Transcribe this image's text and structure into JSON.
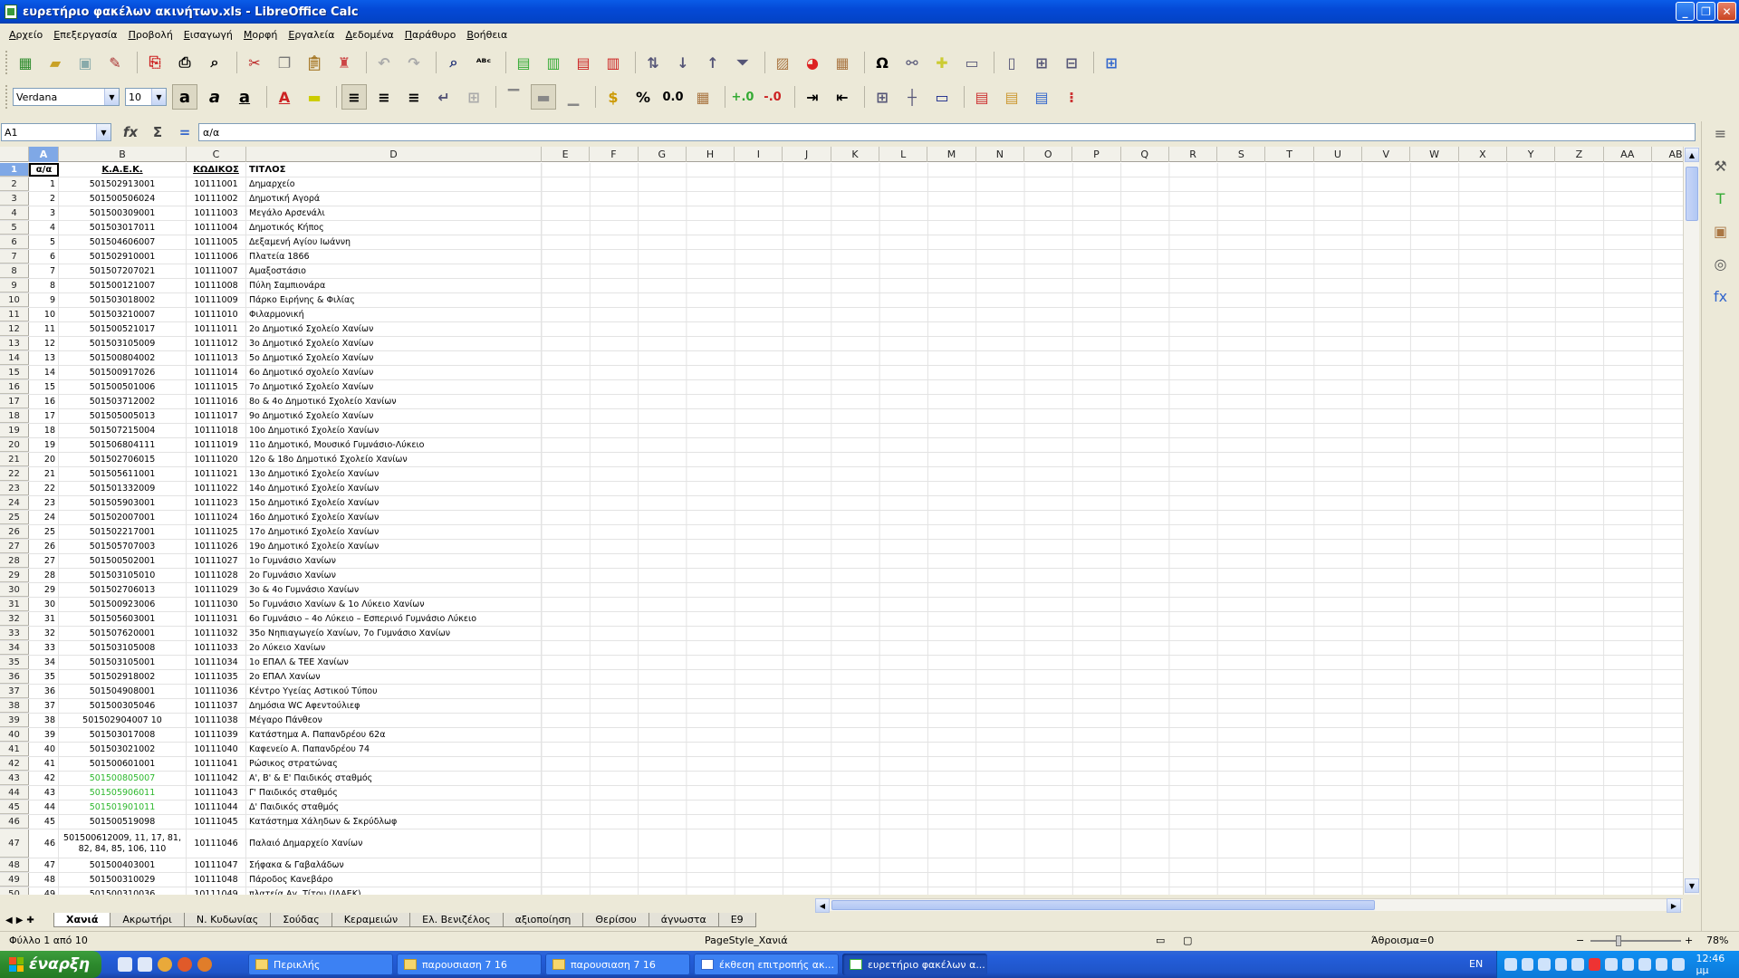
{
  "window": {
    "title": "ευρετήριο φακέλων ακινήτων.xls - LibreOffice Calc"
  },
  "menu": [
    "Αρχείο",
    "Επεξεργασία",
    "Προβολή",
    "Εισαγωγή",
    "Μορφή",
    "Εργαλεία",
    "Δεδομένα",
    "Παράθυρο",
    "Βοήθεια"
  ],
  "format": {
    "font_name": "Verdana",
    "font_size": "10"
  },
  "formula_bar": {
    "cell_ref": "A1",
    "content": "α/α"
  },
  "columns": [
    "A",
    "B",
    "C",
    "D",
    "E",
    "F",
    "G",
    "H",
    "I",
    "J",
    "K",
    "L",
    "M",
    "N",
    "O",
    "P",
    "Q",
    "R",
    "S",
    "T",
    "U",
    "V",
    "W",
    "X",
    "Y",
    "Z",
    "AA",
    "AB"
  ],
  "header_row": {
    "a": "α/α",
    "b": "Κ.Α.Ε.Κ.",
    "c": "ΚΩΔΙΚΟΣ",
    "d": "ΤΙΤΛΟΣ"
  },
  "rows": [
    {
      "n": "1",
      "b": "501502913001",
      "c": "10111001",
      "d": "Δημαρχείο"
    },
    {
      "n": "2",
      "b": "501500506024",
      "c": "10111002",
      "d": "Δημοτική Αγορά"
    },
    {
      "n": "3",
      "b": "501500309001",
      "c": "10111003",
      "d": "Μεγάλο Αρσενάλι"
    },
    {
      "n": "4",
      "b": "501503017011",
      "c": "10111004",
      "d": "Δημοτικός Κήπος"
    },
    {
      "n": "5",
      "b": "501504606007",
      "c": "10111005",
      "d": "Δεξαμενή Αγίου Ιωάννη"
    },
    {
      "n": "6",
      "b": "501502910001",
      "c": "10111006",
      "d": "Πλατεία 1866"
    },
    {
      "n": "7",
      "b": "501507207021",
      "c": "10111007",
      "d": "Αμαξοστάσιο"
    },
    {
      "n": "8",
      "b": "501500121007",
      "c": "10111008",
      "d": "Πύλη Σαμπιονάρα"
    },
    {
      "n": "9",
      "b": "501503018002",
      "c": "10111009",
      "d": "Πάρκο Ειρήνης & Φιλίας"
    },
    {
      "n": "10",
      "b": "501503210007",
      "c": "10111010",
      "d": "Φιλαρμονική"
    },
    {
      "n": "11",
      "b": "501500521017",
      "c": "10111011",
      "d": "2ο Δημοτικό Σχολείο Χανίων"
    },
    {
      "n": "12",
      "b": "501503105009",
      "c": "10111012",
      "d": "3ο Δημοτικό Σχολείο Χανίων"
    },
    {
      "n": "13",
      "b": "501500804002",
      "c": "10111013",
      "d": "5ο Δημοτικό Σχολείο Χανίων"
    },
    {
      "n": "14",
      "b": "501500917026",
      "c": "10111014",
      "d": "6ο Δημοτικό σχολείο Χανίων"
    },
    {
      "n": "15",
      "b": "501500501006",
      "c": "10111015",
      "d": "7ο Δημοτικό Σχολείο Χανίων"
    },
    {
      "n": "16",
      "b": "501503712002",
      "c": "10111016",
      "d": "8ο & 4ο Δημοτικό Σχολείο Χανίων"
    },
    {
      "n": "17",
      "b": "501505005013",
      "c": "10111017",
      "d": "9ο Δημοτικό Σχολείο Χανίων"
    },
    {
      "n": "18",
      "b": "501507215004",
      "c": "10111018",
      "d": "10ο Δημοτικό Σχολείο Χανίων"
    },
    {
      "n": "19",
      "b": "501506804111",
      "c": "10111019",
      "d": "11ο Δημοτικό, Μουσικό Γυμνάσιο-Λύκειο"
    },
    {
      "n": "20",
      "b": "501502706015",
      "c": "10111020",
      "d": "12ο & 18ο Δημοτικό Σχολείο Χανίων"
    },
    {
      "n": "21",
      "b": "501505611001",
      "c": "10111021",
      "d": "13ο Δημοτικό Σχολείο Χανίων"
    },
    {
      "n": "22",
      "b": "501501332009",
      "c": "10111022",
      "d": "14ο Δημοτικό Σχολείο Χανίων"
    },
    {
      "n": "23",
      "b": "501505903001",
      "c": "10111023",
      "d": "15ο Δημοτικό Σχολείο Χανίων"
    },
    {
      "n": "24",
      "b": "501502007001",
      "c": "10111024",
      "d": "16ο Δημοτικό Σχολείο Χανίων"
    },
    {
      "n": "25",
      "b": "501502217001",
      "c": "10111025",
      "d": "17ο Δημοτικό Σχολείο Χανίων"
    },
    {
      "n": "26",
      "b": "501505707003",
      "c": "10111026",
      "d": "19ο Δημοτικό Σχολείο Χανίων"
    },
    {
      "n": "27",
      "b": "501500502001",
      "c": "10111027",
      "d": "1ο Γυμνάσιο Χανίων"
    },
    {
      "n": "28",
      "b": "501503105010",
      "c": "10111028",
      "d": "2ο Γυμνάσιο Χανίων"
    },
    {
      "n": "29",
      "b": "501502706013",
      "c": "10111029",
      "d": "3ο & 4ο Γυμνάσιο Χανίων"
    },
    {
      "n": "30",
      "b": "501500923006",
      "c": "10111030",
      "d": "5ο Γυμνάσιο Χανίων & 1ο Λύκειο Χανίων"
    },
    {
      "n": "31",
      "b": "501505603001",
      "c": "10111031",
      "d": "6ο Γυμνάσιο – 4ο Λύκειο – Εσπερινό Γυμνάσιο Λύκειο"
    },
    {
      "n": "32",
      "b": "501507620001",
      "c": "10111032",
      "d": "35ο Νηπιαγωγείο Χανίων, 7ο Γυμνάσιο Χανίων"
    },
    {
      "n": "33",
      "b": "501503105008",
      "c": "10111033",
      "d": "2ο Λύκειο Χανίων"
    },
    {
      "n": "34",
      "b": "501503105001",
      "c": "10111034",
      "d": "1ο ΕΠΑΛ & ΤΕΕ Χανίων"
    },
    {
      "n": "35",
      "b": "501502918002",
      "c": "10111035",
      "d": "2ο ΕΠΑΛ Χανίων"
    },
    {
      "n": "36",
      "b": "501504908001",
      "c": "10111036",
      "d": "Κέντρο Υγείας Αστικού Τύπου"
    },
    {
      "n": "37",
      "b": "501500305046",
      "c": "10111037",
      "d": "Δημόσια WC Αφεντούλιεφ"
    },
    {
      "n": "38",
      "b": "501502904007 10",
      "c": "10111038",
      "d": "Μέγαρο Πάνθεον"
    },
    {
      "n": "39",
      "b": "501503017008",
      "c": "10111039",
      "d": "Κατάστημα Α. Παπανδρέου 62α"
    },
    {
      "n": "40",
      "b": "501503021002",
      "c": "10111040",
      "d": "Καφενείο Α. Παπανδρέου 74"
    },
    {
      "n": "41",
      "b": "501500601001",
      "c": "10111041",
      "d": "Ρώσικος στρατώνας"
    },
    {
      "n": "42",
      "b": "501500805007",
      "c": "10111042",
      "d": "Α', Β' & Ε' Παιδικός σταθμός",
      "green": true
    },
    {
      "n": "43",
      "b": "501505906011",
      "c": "10111043",
      "d": "Γ' Παιδικός σταθμός",
      "green": true
    },
    {
      "n": "44",
      "b": "501501901011",
      "c": "10111044",
      "d": "Δ' Παιδικός σταθμός",
      "green": true
    },
    {
      "n": "45",
      "b": "501500519098",
      "c": "10111045",
      "d": "Κατάστημα Χάληδων & Σκρύδλωφ"
    },
    {
      "n": "46",
      "b": "501500612009, 11, 17, 81, 82, 84, 85, 106, 110",
      "c": "10111046",
      "d": "Παλαιό Δημαρχείο Χανίων",
      "tall": true
    },
    {
      "n": "47",
      "b": "501500403001",
      "c": "10111047",
      "d": "Σήφακα & Γαβαλάδων"
    },
    {
      "n": "48",
      "b": "501500310029",
      "c": "10111048",
      "d": "Πάροδος Κανεβάρο"
    },
    {
      "n": "49",
      "b": "501500310036",
      "c": "10111049",
      "d": "πλατεία Αγ. Τίτου (ΙΛΑΕΚ)"
    }
  ],
  "sheets": [
    "Χανιά",
    "Ακρωτήρι",
    "Ν. Κυδωνίας",
    "Σούδας",
    "Κεραμειών",
    "Ελ. Βενιζέλος",
    "αξιοποίηση",
    "Θερίσου",
    "άγνωστα",
    "Ε9"
  ],
  "status": {
    "sheet": "Φύλλο 1 από 10",
    "page_style": "PageStyle_Χανιά",
    "sum": "Άθροισμα=0",
    "zoom": "78%"
  },
  "taskbar": {
    "start": "έναρξη",
    "tasks": [
      "Περικλής",
      "παρουσιαση 7 16",
      "παρουσιαση 7 16",
      "έκθεση επιτροπής ακ...",
      "ευρετήριο φακέλων α..."
    ],
    "lang": "EN",
    "clock": "12:46 μμ"
  }
}
